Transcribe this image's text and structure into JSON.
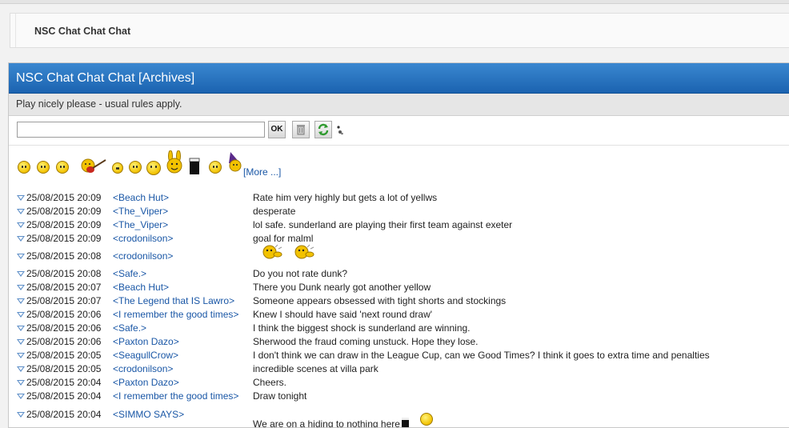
{
  "breadcrumb": {
    "title": "NSC Chat Chat Chat"
  },
  "panel": {
    "title": "NSC Chat Chat Chat  [Archives]",
    "notice": "Play nicely please - usual rules apply."
  },
  "controls": {
    "input_value": "",
    "ok_label": "OK",
    "icons": [
      "ok-icon",
      "trash-icon",
      "refresh-icon",
      "sound-icon"
    ]
  },
  "smilies": {
    "icons": [
      "smile-icon",
      "sad-icon",
      "cool-icon",
      "guitar-icon",
      "grin-icon",
      "laugh-icon",
      "bigsmile-icon",
      "bunny-icon",
      "pint-icon",
      "wink-icon",
      "wizard-icon"
    ],
    "more_label": "[More ...]"
  },
  "messages": [
    {
      "time": "25/08/2015 20:09",
      "user": "<Beach Hut>",
      "text": "Rate him very highly but gets a lot of yellws"
    },
    {
      "time": "25/08/2015 20:09",
      "user": "<The_Viper>",
      "text": "desperate"
    },
    {
      "time": "25/08/2015 20:09",
      "user": "<The_Viper>",
      "text": "lol safe. sunderland are playing their first team against exeter"
    },
    {
      "time": "25/08/2015 20:09",
      "user": "<crodonilson>",
      "text": "goal for malml"
    },
    {
      "time": "25/08/2015 20:08",
      "user": "<crodonilson>",
      "text": "",
      "emoticons": [
        "clap-icon",
        "clap-icon"
      ]
    },
    {
      "time": "25/08/2015 20:08",
      "user": "<Safe.>",
      "text": "Do you not rate dunk?"
    },
    {
      "time": "25/08/2015 20:07",
      "user": "<Beach Hut>",
      "text": "There you Dunk nearly got another yellow"
    },
    {
      "time": "25/08/2015 20:07",
      "user": "<The Legend that IS Lawro>",
      "text": "Someone appears obsessed with tight shorts and stockings"
    },
    {
      "time": "25/08/2015 20:06",
      "user": "<I remember the good times>",
      "text": "Knew I should have said 'next round draw'"
    },
    {
      "time": "25/08/2015 20:06",
      "user": "<Safe.>",
      "text": "I think the biggest shock is sunderland are winning."
    },
    {
      "time": "25/08/2015 20:06",
      "user": "<Paxton Dazo>",
      "text": "Sherwood the fraud coming unstuck. Hope they lose."
    },
    {
      "time": "25/08/2015 20:05",
      "user": "<SeagullCrow>",
      "text": "I don't think we can draw in the League Cup, can we Good Times? I think it goes to extra time and penalties"
    },
    {
      "time": "25/08/2015 20:05",
      "user": "<crodonilson>",
      "text": "incredible scenes at villa park"
    },
    {
      "time": "25/08/2015 20:04",
      "user": "<Paxton Dazo>",
      "text": "Cheers."
    },
    {
      "time": "25/08/2015 20:04",
      "user": "<I remember the good times>",
      "text": "Draw tonight"
    },
    {
      "time": "25/08/2015 20:04",
      "user": "<SIMMO SAYS>",
      "text": "We are on a hiding to nothing here",
      "emoticons": [
        "pint-icon",
        "smile-icon"
      ]
    }
  ]
}
